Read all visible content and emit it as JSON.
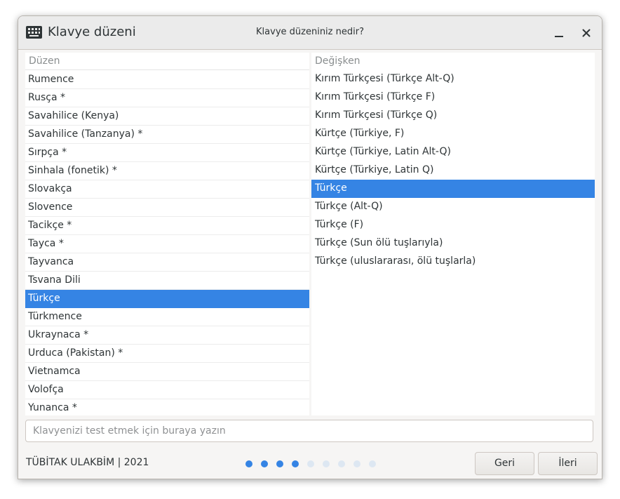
{
  "window": {
    "app_title": "Klavye düzeni",
    "page_title": "Klavye düzeniniz nedir?"
  },
  "layouts": {
    "header": "Düzen",
    "items": [
      "Rumence",
      "Rusça *",
      "Savahilice (Kenya)",
      "Savahilice (Tanzanya) *",
      "Sırpça *",
      "Sinhala (fonetik) *",
      "Slovakça",
      "Slovence",
      "Tacikçe *",
      "Tayca *",
      "Tayvanca",
      "Tsvana Dili",
      "Türkçe",
      "Türkmence",
      "Ukraynaca *",
      "Urduca (Pakistan) *",
      "Vietnamca",
      "Volofça",
      "Yunanca *"
    ],
    "selected_index": 12
  },
  "variants": {
    "header": "Değişken",
    "items": [
      "Kırım Türkçesi (Türkçe Alt-Q)",
      "Kırım Türkçesi (Türkçe F)",
      "Kırım Türkçesi (Türkçe Q)",
      "Kürtçe (Türkiye, F)",
      "Kürtçe (Türkiye, Latin Alt-Q)",
      "Kürtçe (Türkiye, Latin Q)",
      "Türkçe",
      "Türkçe (Alt-Q)",
      "Türkçe (F)",
      "Türkçe (Sun ölü tuşlarıyla)",
      "Türkçe (uluslararası, ölü tuşlarla)"
    ],
    "selected_index": 6
  },
  "test_input": {
    "placeholder": "Klavyenizi test etmek için buraya yazın",
    "value": ""
  },
  "footer": {
    "credit": "TÜBİTAK ULAKBİM | 2021",
    "steps_total": 9,
    "steps_completed": 4,
    "back_label": "Geri",
    "next_label": "İleri"
  },
  "colors": {
    "accent": "#3584e4",
    "dot_inactive": "#dde7f2"
  }
}
